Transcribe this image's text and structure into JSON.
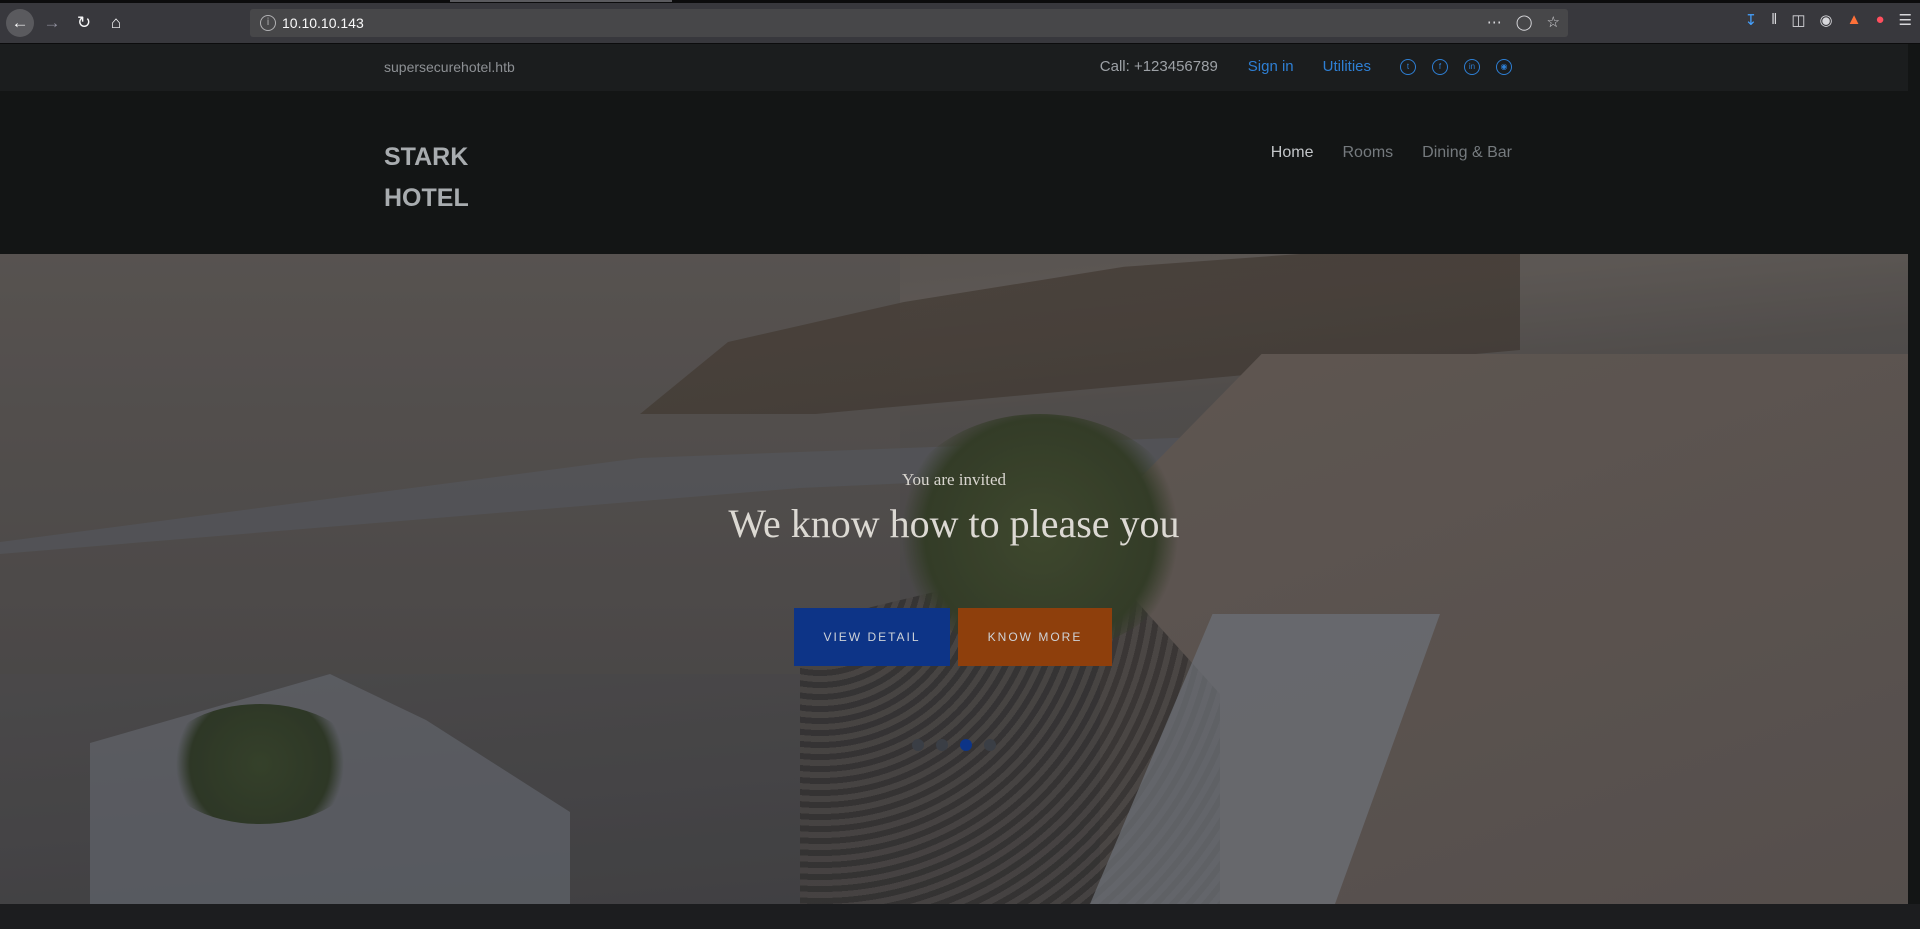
{
  "browser": {
    "url": "10.10.10.143"
  },
  "topbar": {
    "domain": "supersecurehotel.htb",
    "call": "Call: +123456789",
    "signin": "Sign in",
    "utilities": "Utilities",
    "social": [
      "twitter-icon",
      "facebook-icon",
      "linkedin-icon",
      "dribbble-icon"
    ]
  },
  "header": {
    "logo_line1": "STARK",
    "logo_line2": "HOTEL",
    "nav": [
      "Home",
      "Rooms",
      "Dining & Bar"
    ]
  },
  "hero": {
    "subtitle": "You are invited",
    "title": "We know how to please you",
    "btn_view": "VIEW DETAIL",
    "btn_more": "KNOW MORE",
    "slide_count": 4,
    "active_slide": 3
  },
  "colors": {
    "link": "#2e7fd4",
    "btn_view": "#0d3487",
    "btn_more": "#8e3f0c"
  }
}
